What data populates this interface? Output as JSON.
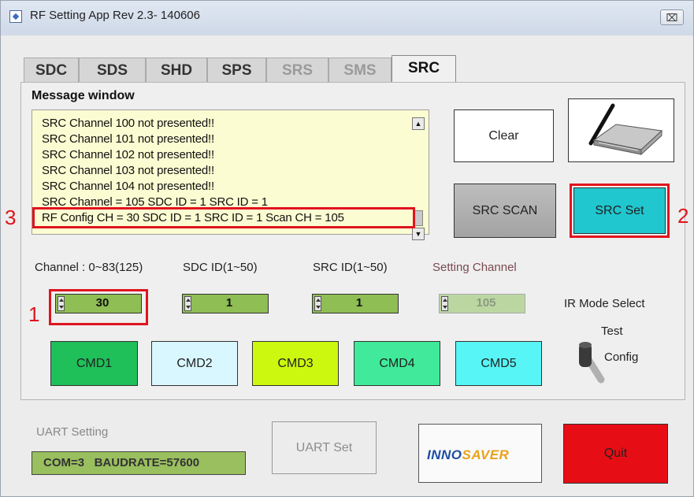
{
  "window": {
    "title": "RF Setting App Rev 2.3- 140606",
    "close_symbol": "⌧"
  },
  "tabs": [
    {
      "label": "SDC",
      "state": "enabled"
    },
    {
      "label": "SDS",
      "state": "enabled"
    },
    {
      "label": "SHD",
      "state": "enabled"
    },
    {
      "label": "SPS",
      "state": "enabled"
    },
    {
      "label": "SRS",
      "state": "disabled"
    },
    {
      "label": "SMS",
      "state": "disabled"
    },
    {
      "label": "SRC",
      "state": "active"
    }
  ],
  "message_window": {
    "title": "Message window",
    "lines": [
      "SRC Channel 100 not presented!!",
      "SRC Channel 101 not presented!!",
      "SRC Channel 102 not presented!!",
      "SRC Channel 103 not presented!!",
      "SRC Channel 104 not presented!!",
      "SRC Channel = 105 SDC ID = 1 SRC ID = 1",
      "RF Config CH = 30 SDC ID = 1 SRC ID = 1 Scan CH = 105"
    ],
    "scroll_up_symbol": "▲",
    "scroll_down_symbol": "▼"
  },
  "buttons": {
    "clear": "Clear",
    "src_scan": "SRC SCAN",
    "src_set": "SRC Set",
    "uart_set": "UART Set",
    "quit": "Quit",
    "device_icon": "router-device-icon"
  },
  "annotations": {
    "marker_1": "1",
    "marker_2": "2",
    "marker_3": "3",
    "color": "#e0141e"
  },
  "fields": {
    "channel": {
      "label": "Channel : 0~83(125)",
      "value": "30"
    },
    "sdc_id": {
      "label": "SDC ID(1~50)",
      "value": "1"
    },
    "src_id": {
      "label": "SRC ID(1~50)",
      "value": "1"
    },
    "setting_channel": {
      "label": "Setting Channel",
      "value": "105"
    }
  },
  "ir_mode": {
    "label": "IR Mode Select",
    "option_top": "Test",
    "option_bottom": "Config"
  },
  "cmd_buttons": [
    {
      "label": "CMD1",
      "color": "#1fbf5a"
    },
    {
      "label": "CMD2",
      "color": "#d9f7ff"
    },
    {
      "label": "CMD3",
      "color": "#ccf70f"
    },
    {
      "label": "CMD4",
      "color": "#40ea9a"
    },
    {
      "label": "CMD5",
      "color": "#57f5f5"
    }
  ],
  "uart": {
    "label": "UART Setting",
    "display": "COM=3   BAUDRATE=57600"
  },
  "logo": {
    "part1": "INNO",
    "part2": "SAVER",
    "color1": "#1d4fa3",
    "color2": "#e8a21a"
  }
}
